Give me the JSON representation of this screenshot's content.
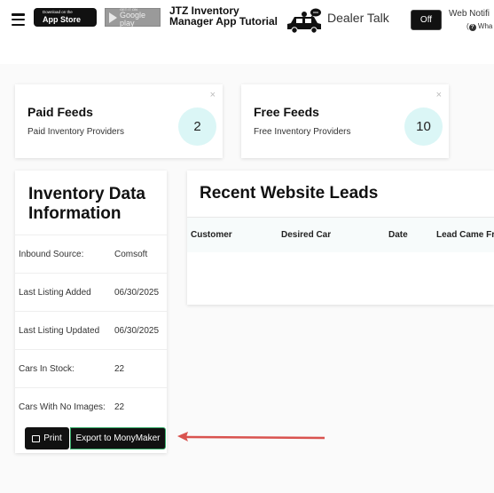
{
  "header": {
    "app_store": {
      "small": "Download on the",
      "big": "App Store"
    },
    "google_play": {
      "small": "GET IT ON",
      "big": "Google play"
    },
    "app_title": "JTZ Inventory Manager App Tutorial",
    "dealer_talk": "Dealer Talk",
    "toggle_label": "Off",
    "web_notifications": "Web Notifi",
    "web_notifications_sub": "Wha"
  },
  "feeds": {
    "paid": {
      "title": "Paid Feeds",
      "subtitle": "Paid Inventory Providers",
      "count": "2",
      "close": "×"
    },
    "free": {
      "title": "Free Feeds",
      "subtitle": "Free Inventory Providers",
      "count": "10",
      "close": "×"
    }
  },
  "inventory": {
    "heading": "Inventory Data Information",
    "rows": [
      {
        "label": "Inbound Source:",
        "value": "Comsoft"
      },
      {
        "label": "Last Listing Added",
        "value": "06/30/2025"
      },
      {
        "label": "Last Listing Updated",
        "value": "06/30/2025"
      },
      {
        "label": "Cars In Stock:",
        "value": "22"
      },
      {
        "label": "Cars With No Images:",
        "value": "22"
      }
    ],
    "print_label": "Print",
    "export_label": "Export to MonyMaker"
  },
  "leads": {
    "heading": "Recent Website Leads",
    "columns": [
      "Customer",
      "Desired Car",
      "Date",
      "Lead Came Fro"
    ]
  },
  "colors": {
    "accent_circle": "#dbf6f6",
    "arrow": "#d9534f",
    "button": "#111111"
  }
}
